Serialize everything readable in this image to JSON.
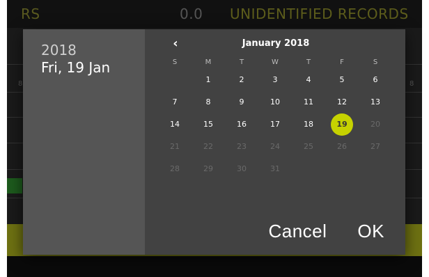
{
  "background": {
    "header_left": "RS",
    "header_mid": "0.0",
    "header_right": "UNIDENTIFIED RECORDS",
    "side_left_mark": "8",
    "side_right_mark": "8"
  },
  "picker": {
    "selected_year": "2018",
    "selected_date": "Fri, 19 Jan",
    "month_title": "January 2018",
    "prev_icon": "chevron-left-icon",
    "weekdays": [
      "S",
      "M",
      "T",
      "W",
      "T",
      "F",
      "S"
    ],
    "days": [
      "",
      "1",
      "2",
      "3",
      "4",
      "5",
      "6",
      "7",
      "8",
      "9",
      "10",
      "11",
      "12",
      "13",
      "14",
      "15",
      "16",
      "17",
      "18",
      "19",
      "20",
      "21",
      "22",
      "23",
      "24",
      "25",
      "26",
      "27",
      "28",
      "29",
      "30",
      "31",
      "",
      "",
      ""
    ],
    "selected_day": "19",
    "enabled_max_day": 19,
    "accent_color": "#c6d200"
  },
  "actions": {
    "cancel": "Cancel",
    "ok": "OK"
  }
}
